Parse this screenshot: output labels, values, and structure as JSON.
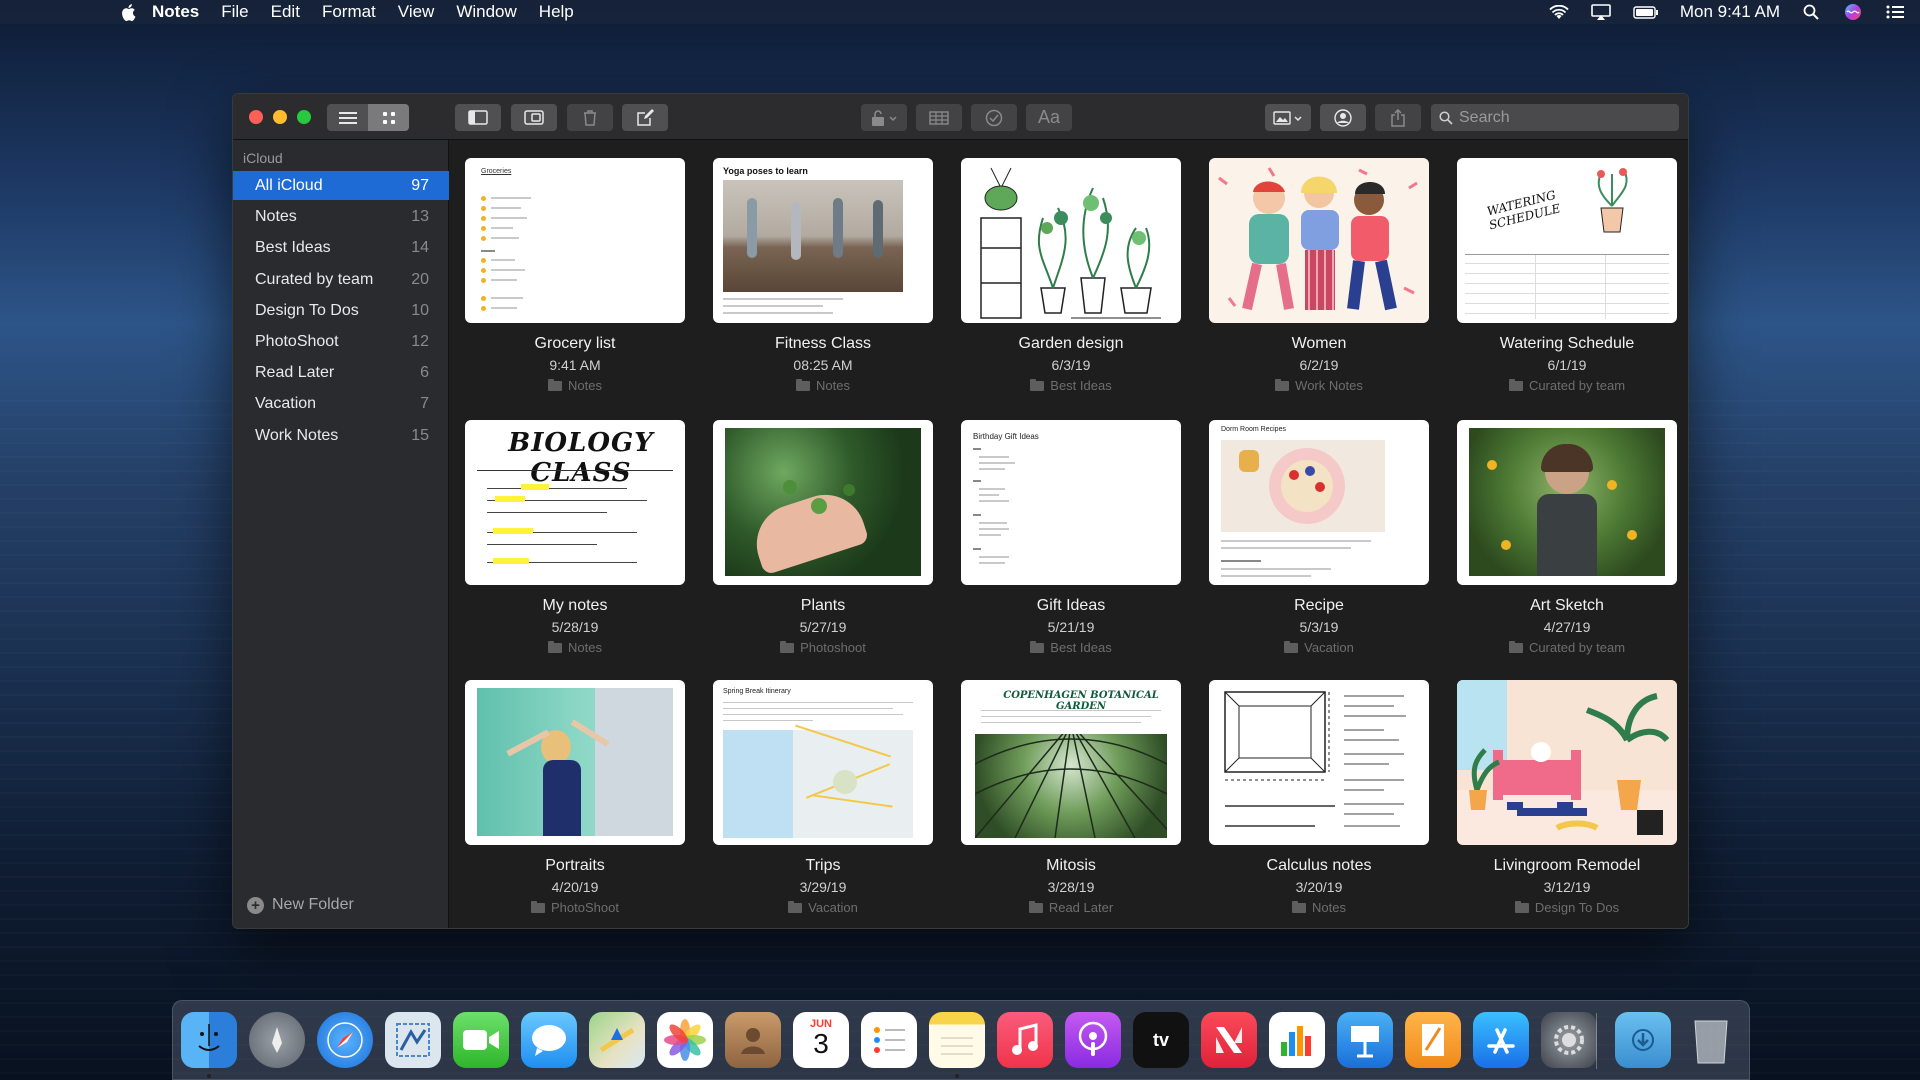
{
  "menubar": {
    "app": "Notes",
    "items": [
      "File",
      "Edit",
      "Format",
      "View",
      "Window",
      "Help"
    ],
    "clock": "Mon 9:41 AM",
    "status_icons": [
      "wifi-icon",
      "airplay-icon",
      "battery-icon",
      "spotlight-icon",
      "siri-icon",
      "notification-center-icon"
    ]
  },
  "toolbar": {
    "search_placeholder": "Search",
    "format_label": "Aa"
  },
  "sidebar": {
    "header": "iCloud",
    "items": [
      {
        "label": "All iCloud",
        "count": "97"
      },
      {
        "label": "Notes",
        "count": "13"
      },
      {
        "label": "Best Ideas",
        "count": "14"
      },
      {
        "label": "Curated by team",
        "count": "20"
      },
      {
        "label": "Design To Dos",
        "count": "10"
      },
      {
        "label": "PhotoShoot",
        "count": "12"
      },
      {
        "label": "Read Later",
        "count": "6"
      },
      {
        "label": "Vacation",
        "count": "7"
      },
      {
        "label": "Work Notes",
        "count": "15"
      }
    ],
    "new_folder": "New Folder"
  },
  "notes": [
    {
      "title": "Grocery list",
      "date": "9:41 AM",
      "folder": "Notes",
      "thumb_heading": "Groceries"
    },
    {
      "title": "Fitness Class",
      "date": "08:25 AM",
      "folder": "Notes",
      "thumb_heading": "Yoga poses to learn"
    },
    {
      "title": "Garden design",
      "date": "6/3/19",
      "folder": "Best Ideas"
    },
    {
      "title": "Women",
      "date": "6/2/19",
      "folder": "Work Notes"
    },
    {
      "title": "Watering Schedule",
      "date": "6/1/19",
      "folder": "Curated by team",
      "thumb_heading": "WATERING SCHEDULE"
    },
    {
      "title": "My notes",
      "date": "5/28/19",
      "folder": "Notes",
      "thumb_heading": "BIOLOGY CLASS"
    },
    {
      "title": "Plants",
      "date": "5/27/19",
      "folder": "Photoshoot"
    },
    {
      "title": "Gift Ideas",
      "date": "5/21/19",
      "folder": "Best Ideas",
      "thumb_heading": "Birthday Gift Ideas"
    },
    {
      "title": "Recipe",
      "date": "5/3/19",
      "folder": "Vacation",
      "thumb_heading": "Dorm Room Recipes"
    },
    {
      "title": "Art Sketch",
      "date": "4/27/19",
      "folder": "Curated by team"
    },
    {
      "title": "Portraits",
      "date": "4/20/19",
      "folder": "PhotoShoot"
    },
    {
      "title": "Trips",
      "date": "3/29/19",
      "folder": "Vacation",
      "thumb_heading": "Spring Break Itinerary"
    },
    {
      "title": "Mitosis",
      "date": "3/28/19",
      "folder": "Read Later",
      "thumb_heading": "COPENHAGEN BOTANICAL GARDEN"
    },
    {
      "title": "Calculus notes",
      "date": "3/20/19",
      "folder": "Notes"
    },
    {
      "title": "Livingroom Remodel",
      "date": "3/12/19",
      "folder": "Design To Dos"
    }
  ],
  "dock": {
    "apps": [
      "finder-icon",
      "launchpad-icon",
      "safari-icon",
      "mail-icon",
      "facetime-icon",
      "messages-icon",
      "maps-icon",
      "photos-icon",
      "contacts-icon",
      "calendar-icon",
      "reminders-icon",
      "notes-icon",
      "music-icon",
      "podcasts-icon",
      "tv-icon",
      "news-icon",
      "numbers-icon",
      "keynote-icon",
      "pages-icon",
      "app-store-icon",
      "system-preferences-icon",
      "downloads-folder-icon",
      "trash-icon"
    ],
    "calendar_month": "JUN",
    "calendar_day": "3",
    "tv_label": "tv"
  }
}
